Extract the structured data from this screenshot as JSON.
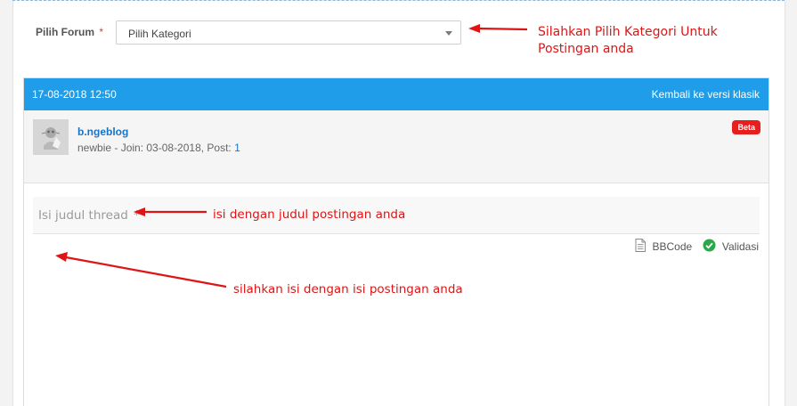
{
  "forum_field": {
    "label": "Pilih Forum",
    "required_mark": "*",
    "selected_value": "Pilih Kategori"
  },
  "annotations": {
    "category": "Silahkan Pilih Kategori Untuk Postingan anda",
    "title": "isi dengan judul postingan anda",
    "content": "silahkan isi dengan isi postingan anda"
  },
  "post_header": {
    "date": "17-08-2018 12:50",
    "classic_link": "Kembali ke versi klasik"
  },
  "user": {
    "username": "b.ngeblog",
    "meta_prefix": "newbie - Join: 03-08-2018, Post: ",
    "post_count": "1",
    "badge": "Beta"
  },
  "title_field": {
    "placeholder": "Isi judul thread",
    "required_mark": "*"
  },
  "editor_tools": {
    "bbcode_label": "BBCode",
    "validate_label": "Validasi"
  },
  "colors": {
    "accent_blue": "#1f9de8",
    "annotation_red": "#e01414",
    "badge_red": "#e61e1e",
    "link_blue": "#1a74c6",
    "validate_green": "#2aa84a"
  },
  "icons": {
    "bbcode": "document-icon",
    "validate": "check-circle-icon",
    "dropdown": "chevron-down-icon"
  }
}
